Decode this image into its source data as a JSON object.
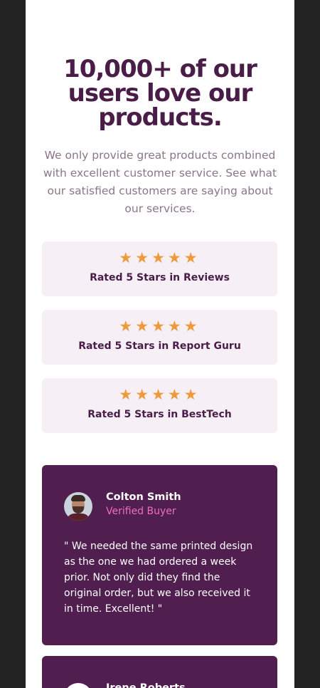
{
  "hero": {
    "heading_lines": [
      "10,000+ of our",
      "users love our",
      "products."
    ],
    "intro": "We only provide great products combined with excellent customer service. See what our satisfied customers are saying about our services."
  },
  "ratings": [
    {
      "stars": 5,
      "label": "Rated 5 Stars in Reviews"
    },
    {
      "stars": 5,
      "label": "Rated 5 Stars in Report Guru"
    },
    {
      "stars": 5,
      "label": "Rated 5 Stars in BestTech"
    }
  ],
  "testimonials": [
    {
      "name": "Colton Smith",
      "role": "Verified Buyer",
      "quote": "\" We needed the same printed design as the one we had ordered a week prior. Not only did they find the original order, but we also received it in time. Excellent! \""
    },
    {
      "name": "Irene Roberts",
      "role": "",
      "quote": ""
    }
  ],
  "colors": {
    "page_bg": "#222222",
    "heading": "#4a1d48",
    "star": "#ee9a3c",
    "card_bg": "#501e4f",
    "role": "#ee6fbd",
    "rating_bg": "#f6f0f6"
  }
}
